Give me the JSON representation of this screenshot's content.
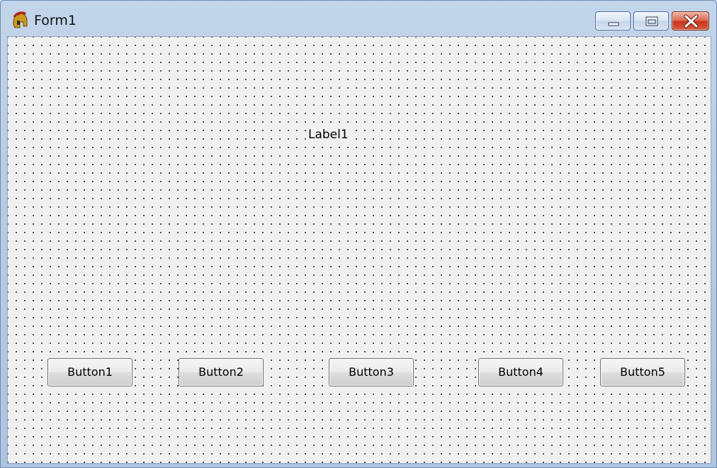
{
  "window": {
    "title": "Form1",
    "icon": "spartan-helmet-icon",
    "controls": {
      "minimize_icon": "minimize-icon",
      "maximize_icon": "maximize-icon",
      "close_icon": "close-icon"
    }
  },
  "form": {
    "label": "Label1",
    "buttons": [
      "Button1",
      "Button2",
      "Button3",
      "Button4",
      "Button5"
    ]
  },
  "colors": {
    "titlebar": "#b7cbe3",
    "client_background": "#f0f0f0",
    "close_button": "#c7371d"
  }
}
